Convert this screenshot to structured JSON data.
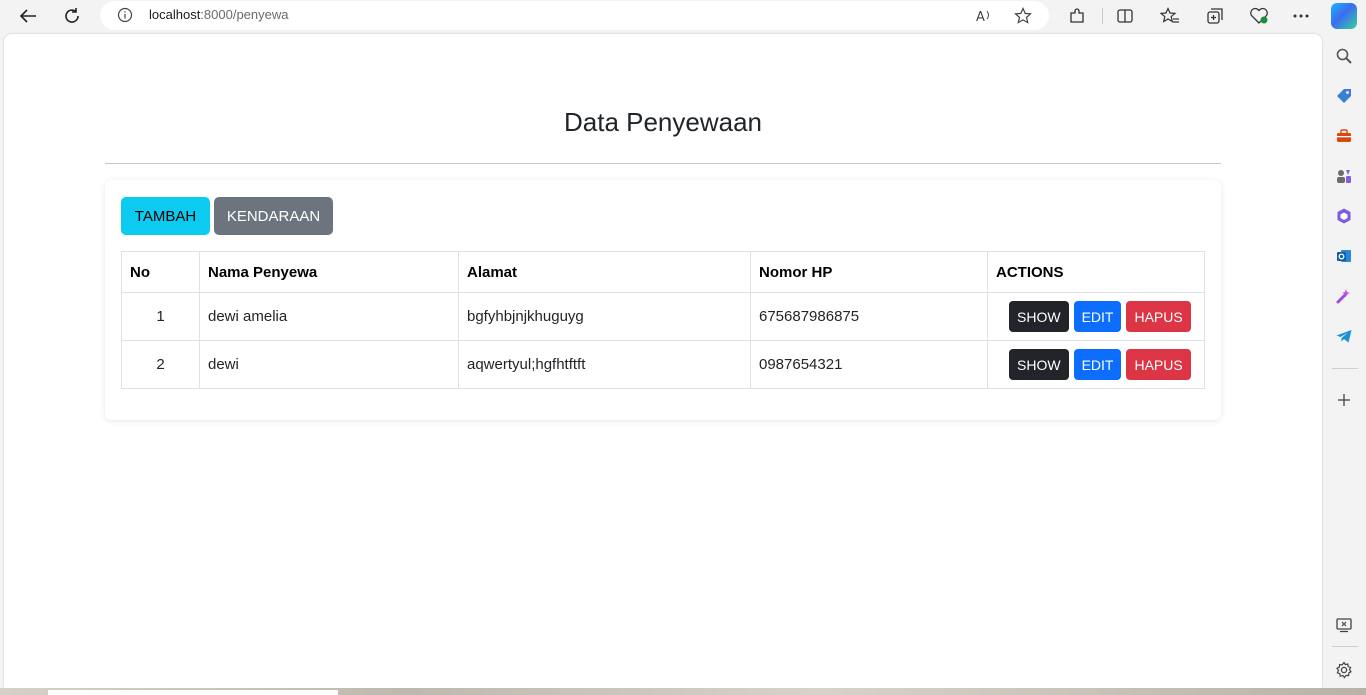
{
  "browser": {
    "url_host": "localhost",
    "url_path": ":8000/penyewa",
    "icons": [
      "back-arrow-icon",
      "refresh-icon",
      "info-icon",
      "read-aloud-icon",
      "favorite-star-icon",
      "extensions-icon",
      "split-screen-icon",
      "favorites-icon",
      "collections-icon",
      "browser-essentials-icon",
      "more-icon",
      "copilot-icon"
    ]
  },
  "sidebar": {
    "icons": [
      "search-icon",
      "shopping-tag-icon",
      "toolbox-icon",
      "games-icon",
      "microsoft365-icon",
      "outlook-icon",
      "designer-icon",
      "telegram-icon",
      "add-icon",
      "screenshot-icon",
      "settings-icon"
    ]
  },
  "page": {
    "title": "Data Penyewaan",
    "buttons": {
      "tambah": "TAMBAH",
      "kendaraan": "KENDARAAN"
    },
    "table": {
      "headers": [
        "No",
        "Nama Penyewa",
        "Alamat",
        "Nomor HP",
        "ACTIONS"
      ],
      "rows": [
        {
          "no": "1",
          "nama": "dewi amelia",
          "alamat": "bgfyhbjnjkhuguyg",
          "hp": "675687986875"
        },
        {
          "no": "2",
          "nama": "dewi",
          "alamat": "aqwertyul;hgfhtftft",
          "hp": "0987654321"
        }
      ],
      "actions": {
        "show": "SHOW",
        "edit": "EDIT",
        "hapus": "HAPUS"
      }
    }
  },
  "colors": {
    "info": "#0dcaf0",
    "secondary": "#6c757d",
    "dark": "#212529",
    "primary": "#0d6efd",
    "danger": "#dc3545"
  }
}
